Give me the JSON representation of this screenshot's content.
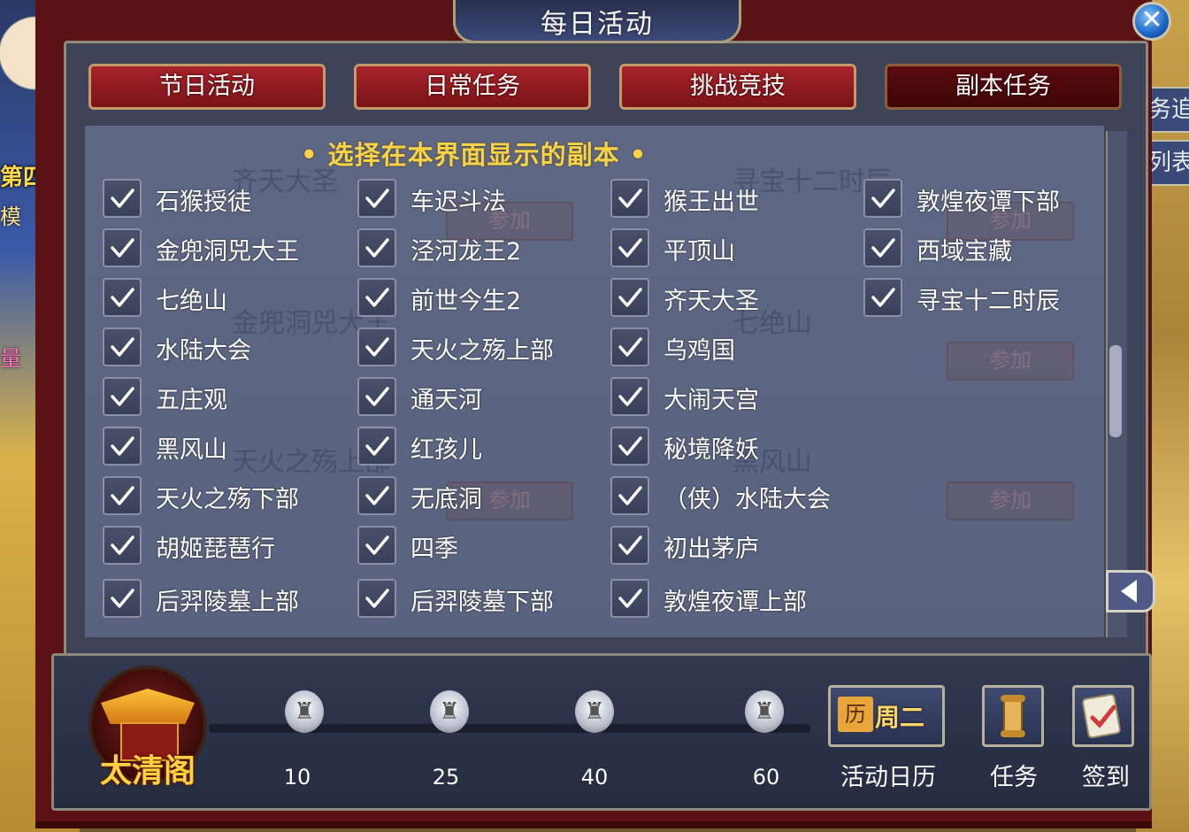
{
  "window": {
    "title": "每日活动",
    "close_glyph": "✕"
  },
  "tabs": [
    {
      "label": "节日活动",
      "active": false
    },
    {
      "label": "日常任务",
      "active": false
    },
    {
      "label": "挑战竞技",
      "active": false
    },
    {
      "label": "副本任务",
      "active": true
    }
  ],
  "panel": {
    "header": "• 选择在本界面显示的副本 •",
    "columns": [
      [
        "石猴授徒",
        "金兜洞兕大王",
        "七绝山",
        "水陆大会",
        "五庄观",
        "黑风山",
        "天火之殇下部",
        "胡姬琵琶行",
        "后羿陵墓上部"
      ],
      [
        "车迟斗法",
        "泾河龙王2",
        "前世今生2",
        "天火之殇上部",
        "通天河",
        "红孩儿",
        "无底洞",
        "四季",
        "后羿陵墓下部"
      ],
      [
        "猴王出世",
        "平顶山",
        "齐天大圣",
        "乌鸡国",
        "大闹天宫",
        "秘境降妖",
        "（侠）水陆大会",
        "初出茅庐",
        "敦煌夜谭上部"
      ],
      [
        "敦煌夜谭下部",
        "西域宝藏",
        "寻宝十二时辰"
      ]
    ],
    "checked": true,
    "background": {
      "titles": [
        "齐天大圣",
        "寻宝十二时辰",
        "金兜洞兕大王",
        "七绝山",
        "天火之殇上部",
        "黑风山"
      ],
      "join_label": "参加"
    }
  },
  "bottom": {
    "pavilion_label": "太清阁",
    "milestones": [
      "10",
      "25",
      "40",
      "60"
    ],
    "calendar": {
      "icon_text": "历",
      "day": "周二",
      "label": "活动日历"
    },
    "task_label": "任务",
    "signin_label": "签到"
  },
  "background_scene": {
    "left_text_1": "第四",
    "left_text_2": "模",
    "left_text_3": "量",
    "right_tab_1": "务追",
    "right_tab_2": "列表"
  },
  "colors": {
    "tab_red": "#a8232a",
    "frame_red": "#5b1214",
    "panel_blue": "#5e6884",
    "header_gold": "#f7d34a"
  }
}
